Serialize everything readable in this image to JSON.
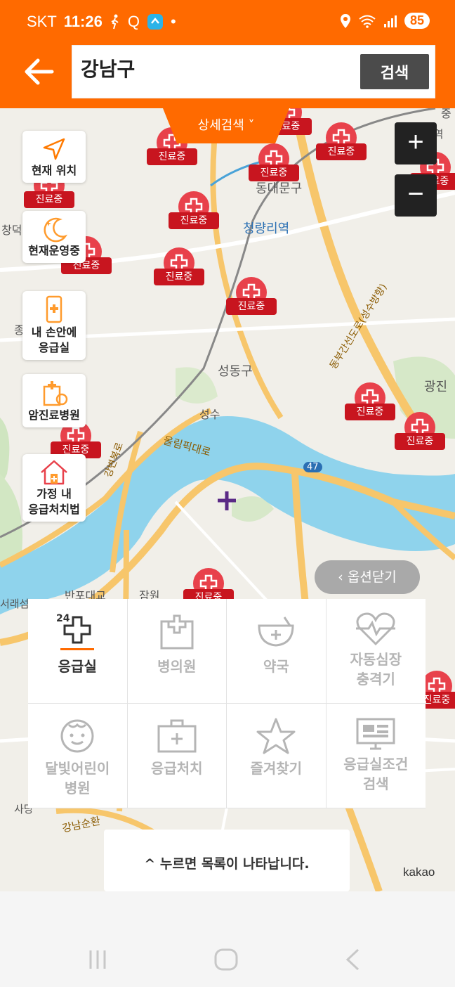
{
  "status": {
    "carrier": "SKT",
    "time": "11:26",
    "extra": "Q",
    "battery": "85"
  },
  "search": {
    "value": "강남구",
    "button": "검색"
  },
  "detail_search": "상세검색 ˅",
  "side_buttons": [
    "현재 위치",
    "현재운영중",
    "내 손안에\n응급실",
    "암진료병원",
    "가정 내\n응급처치법"
  ],
  "marker_label": "진료중",
  "map_labels": {
    "dongdaemun": "동대문구",
    "cheongnyangni": "청량리역",
    "seongdong": "성동구",
    "seongsu": "성수",
    "gwangjin": "광진",
    "olympic": "올림픽대로",
    "banpo": "반포대교",
    "jamwon": "잠원",
    "gangnamsunhwan": "강남순환",
    "sadang": "사당",
    "changdeok": "창덕",
    "jong": "종",
    "rt47": "47",
    "seorae": "서래섬",
    "gangbyeon": "강변북로",
    "yongbi": "동부간선도로(성수방향)",
    "jungnang": "중",
    "sangbong": "상봉역"
  },
  "zoom": {
    "in": "+",
    "out": "−"
  },
  "option_close": "옵션닫기",
  "categories": [
    {
      "label": "응급실",
      "icon": "emergency-room-icon",
      "active": true
    },
    {
      "label": "병의원",
      "icon": "hospital-icon",
      "active": false
    },
    {
      "label": "약국",
      "icon": "pharmacy-icon",
      "active": false
    },
    {
      "label": "자동심장\n충격기",
      "icon": "defibrillator-icon",
      "active": false
    },
    {
      "label": "달빛어린이\n병원",
      "icon": "child-face-icon",
      "active": false
    },
    {
      "label": "응급처치",
      "icon": "first-aid-kit-icon",
      "active": false
    },
    {
      "label": "즐겨찾기",
      "icon": "star-icon",
      "active": false
    },
    {
      "label": "응급실조건\n검색",
      "icon": "monitor-icon",
      "active": false
    }
  ],
  "list_toggle": "^ 누르면 목록이 나타납니다.",
  "map_credit": "kakao",
  "colors": {
    "brand": "#ff6a00",
    "marker": "#e8414b",
    "river": "#8fd3ec"
  }
}
